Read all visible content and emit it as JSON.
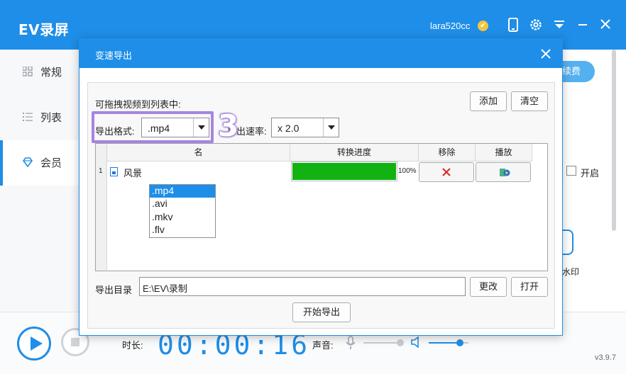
{
  "app": {
    "title": "EV录屏",
    "user": "lara520cc",
    "vip_badge": "✔"
  },
  "sidebar": {
    "items": [
      {
        "label": "常规",
        "icon": "grid-icon"
      },
      {
        "label": "列表",
        "icon": "list-icon"
      },
      {
        "label": "会员",
        "icon": "diamond-icon",
        "active": true
      }
    ]
  },
  "right_panel": {
    "button_label": "续费",
    "checkbox_label": "开启",
    "fragment_label": "水印"
  },
  "bottom": {
    "duration_label": "时长:",
    "timer": "00:00:16",
    "volume_label": "声音:",
    "mic_level": 0.92,
    "speaker_level": 0.78,
    "version": "v3.9.7"
  },
  "dialog": {
    "title": "变速导出",
    "drag_hint": "可拖拽视频到列表中:",
    "add_label": "添加",
    "clear_label": "清空",
    "format_label": "导出格式:",
    "format_value": ".mp4",
    "format_options": [
      ".mp4",
      ".avi",
      ".mkv",
      ".flv"
    ],
    "speed_label": "导出速率:",
    "speed_value": "x 2.0",
    "step_number": "3",
    "columns": {
      "name": "名",
      "progress": "转换进度",
      "remove": "移除",
      "play": "播放"
    },
    "rows": [
      {
        "index": "1",
        "name": "风景",
        "progress": 1.0,
        "progress_text": "100%"
      }
    ],
    "dir_label": "导出目录",
    "dir_value": "E:\\EV\\录制",
    "change_label": "更改",
    "open_label": "打开",
    "start_label": "开始导出"
  },
  "colors": {
    "primary": "#1e8ee8",
    "progress": "#11b211",
    "highlight": "#a685e0"
  }
}
